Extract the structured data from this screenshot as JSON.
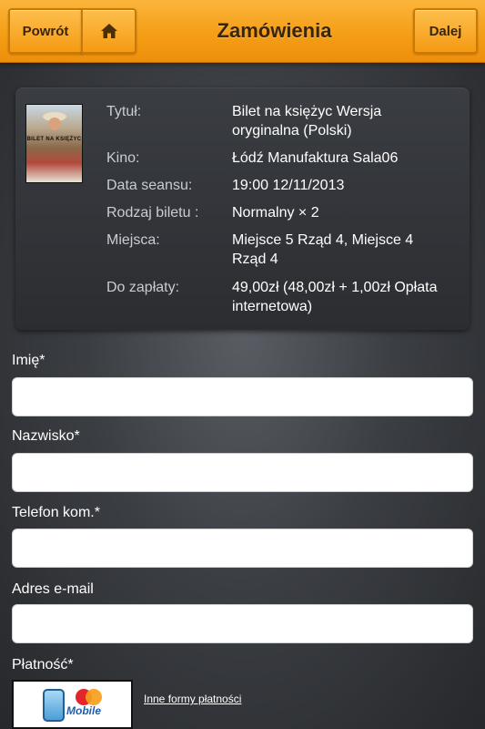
{
  "header": {
    "back_label": "Powrót",
    "home_icon": "home-icon",
    "title": "Zamówienia",
    "next_label": "Dalej"
  },
  "order": {
    "poster_title": "BILET NA KSIĘŻYC",
    "title_label": "Tytuł:",
    "title_value": "Bilet na księżyc Wersja oryginalna (Polski)",
    "cinema_label": "Kino:",
    "cinema_value": "Łódź Manufaktura Sala06",
    "date_label": "Data seansu:",
    "date_value": "19:00 12/11/2013",
    "ticket_label": "Rodzaj biletu :",
    "ticket_value": "Normalny × 2",
    "seats_label": "Miejsca:",
    "seats_value": "Miejsce 5 Rząd 4, Miejsce 4 Rząd 4",
    "pay_label": "Do zapłaty:",
    "pay_value": "49,00zł (48,00zł + 1,00zł Opłata internetowa)"
  },
  "form": {
    "first_name_label": "Imię*",
    "first_name_value": "",
    "last_name_label": "Nazwisko*",
    "last_name_value": "",
    "phone_label": "Telefon kom.*",
    "phone_value": "",
    "email_label": "Adres e-mail",
    "email_value": "",
    "payment_label": "Płatność*",
    "payment_option": "MasterCard Mobile",
    "payment_mobile_text": "Mobile",
    "other_payments": "Inne formy płatności"
  },
  "colors": {
    "header_orange": "#f59e16",
    "header_text": "#3a2606"
  }
}
